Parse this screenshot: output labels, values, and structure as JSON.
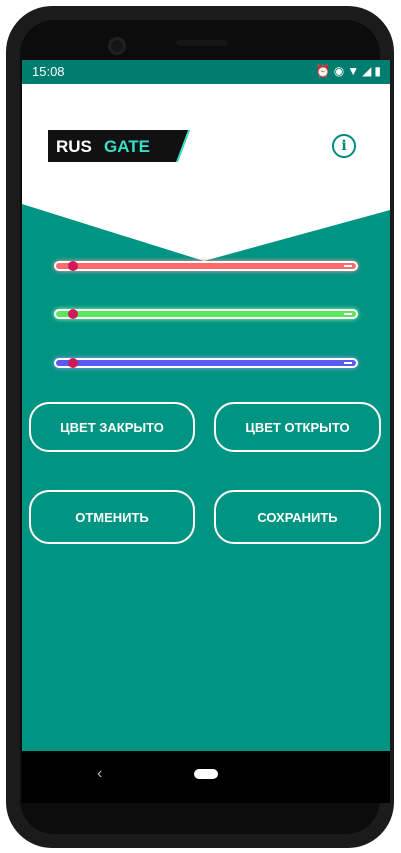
{
  "status_bar": {
    "time": "15:08",
    "icons": [
      "alarm-icon",
      "vibrate-icon",
      "wifi-icon",
      "signal-icon",
      "battery-icon"
    ]
  },
  "header": {
    "logo_left": "RUS",
    "logo_right": "GATE",
    "info_icon": "info-icon",
    "info_glyph": "i"
  },
  "sliders": [
    {
      "name": "red",
      "value": 0.03,
      "color": "#ff6b6b",
      "glow": "#ff9a9a"
    },
    {
      "name": "green",
      "value": 0.03,
      "color": "#5ce65c",
      "glow": "#a0ffa0"
    },
    {
      "name": "blue",
      "value": 0.03,
      "color": "#5a5af0",
      "glow": "#9a9aff"
    }
  ],
  "buttons": {
    "color_closed": "ЦВЕТ ЗАКРЫТО",
    "color_open": "ЦВЕТ ОТКРЫТО",
    "cancel": "ОТМЕНИТЬ",
    "save": "СОХРАНИТЬ"
  },
  "nav": {
    "back": "‹"
  },
  "colors": {
    "primary": "#009483",
    "status_bar": "#007d6e",
    "thumb": "#d0195c",
    "logo_accent": "#36e0c6"
  }
}
